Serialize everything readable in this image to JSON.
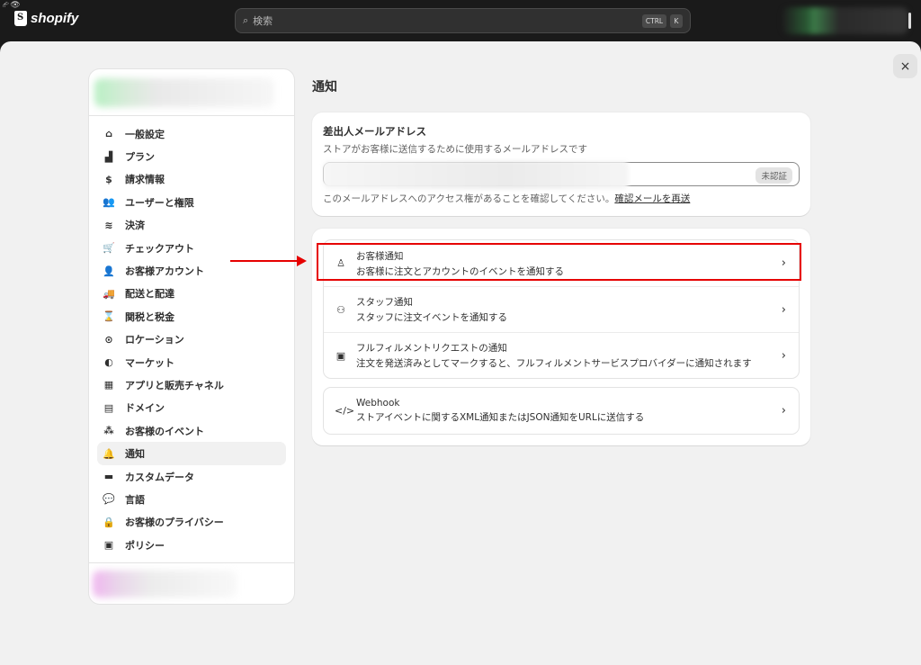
{
  "topbar": {
    "tiny_icons": "⮳👁",
    "logo_text": "shopify",
    "search_placeholder": "検索",
    "search_icon": "search-icon",
    "shortcut_ctrl": "CTRL",
    "shortcut_k": "K"
  },
  "close_label": "×",
  "sidebar": {
    "items": [
      {
        "icon": "store-icon",
        "glyph": "⌂",
        "label": "一般設定"
      },
      {
        "icon": "chart-icon",
        "glyph": "▟",
        "label": "プラン"
      },
      {
        "icon": "billing-icon",
        "glyph": "$",
        "label": "請求情報"
      },
      {
        "icon": "users-icon",
        "glyph": "👥",
        "label": "ユーザーと権限"
      },
      {
        "icon": "payments-icon",
        "glyph": "≋",
        "label": "決済"
      },
      {
        "icon": "cart-icon",
        "glyph": "🛒",
        "label": "チェックアウト"
      },
      {
        "icon": "person-icon",
        "glyph": "👤",
        "label": "お客様アカウント"
      },
      {
        "icon": "truck-icon",
        "glyph": "🚚",
        "label": "配送と配達"
      },
      {
        "icon": "tax-icon",
        "glyph": "⌛",
        "label": "関税と税金"
      },
      {
        "icon": "location-icon",
        "glyph": "⊙",
        "label": "ロケーション"
      },
      {
        "icon": "globe-icon",
        "glyph": "◐",
        "label": "マーケット"
      },
      {
        "icon": "apps-icon",
        "glyph": "▦",
        "label": "アプリと販売チャネル"
      },
      {
        "icon": "domain-icon",
        "glyph": "▤",
        "label": "ドメイン"
      },
      {
        "icon": "cursor-icon",
        "glyph": "⁂",
        "label": "お客様のイベント"
      },
      {
        "icon": "bell-icon",
        "glyph": "🔔",
        "label": "通知"
      },
      {
        "icon": "database-icon",
        "glyph": "▬",
        "label": "カスタムデータ"
      },
      {
        "icon": "language-icon",
        "glyph": "💬",
        "label": "言語"
      },
      {
        "icon": "lock-icon",
        "glyph": "🔒",
        "label": "お客様のプライバシー"
      },
      {
        "icon": "policy-icon",
        "glyph": "▣",
        "label": "ポリシー"
      }
    ],
    "active_index": 14
  },
  "main": {
    "page_title": "通知",
    "sender": {
      "title": "差出人メールアドレス",
      "subtitle": "ストアがお客様に送信するために使用するメールアドレスです",
      "badge": "未認証",
      "note": "このメールアドレスへのアクセス権があることを確認してください。",
      "link": "確認メールを再送"
    },
    "rows": [
      {
        "icon": "person-icon",
        "glyph": "♙",
        "title": "お客様通知",
        "subtitle": "お客様に注文とアカウントのイベントを通知する"
      },
      {
        "icon": "staff-icon",
        "glyph": "⚇",
        "title": "スタッフ通知",
        "subtitle": "スタッフに注文イベントを通知する"
      },
      {
        "icon": "fulfillment-icon",
        "glyph": "▣",
        "title": "フルフィルメントリクエストの通知",
        "subtitle": "注文を発送済みとしてマークすると、フルフィルメントサービスプロバイダーに通知されます"
      }
    ],
    "webhook": {
      "icon": "code-icon",
      "glyph": "</>",
      "title": "Webhook",
      "subtitle": "ストアイベントに関するXML通知またはJSON通知をURLに送信する"
    },
    "chevron": "›"
  },
  "annotation": {
    "color": "#e60000"
  }
}
